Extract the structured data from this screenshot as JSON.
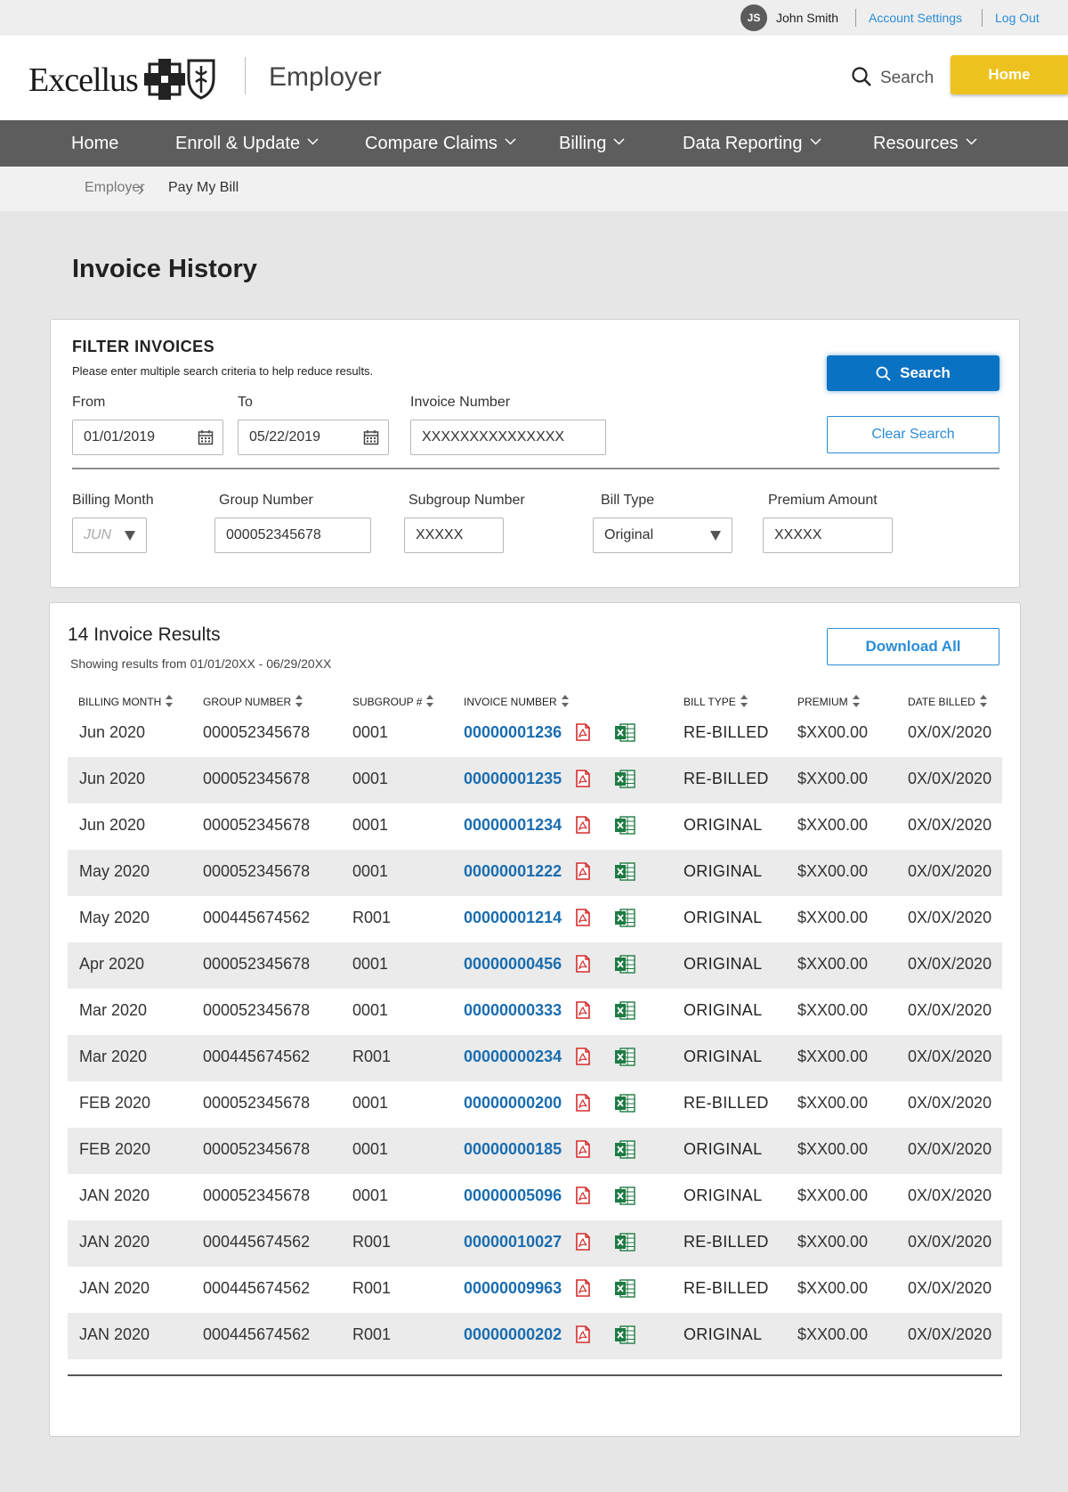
{
  "user": {
    "initials": "JS",
    "name": "John Smith",
    "account_settings": "Account Settings",
    "log_out": "Log Out"
  },
  "header": {
    "logo": "Excellus",
    "portal": "Employer",
    "search_label": "Search",
    "home_button": "Home"
  },
  "nav": [
    "Home",
    "Enroll & Update",
    "Compare Claims",
    "Billing",
    "Data Reporting",
    "Resources"
  ],
  "breadcrumb": {
    "parent": "Employer",
    "current": "Pay My Bill"
  },
  "page": {
    "title": "Invoice History"
  },
  "filter": {
    "title": "FILTER INVOICES",
    "subtitle": "Please enter multiple search criteria to help reduce results.",
    "from_label": "From",
    "from_value": "01/01/2019",
    "to_label": "To",
    "to_value": "05/22/2019",
    "invoice_label": "Invoice Number",
    "invoice_value": "XXXXXXXXXXXXXXX",
    "billing_month_label": "Billing Month",
    "billing_month_value": "JUN",
    "group_label": "Group Number",
    "group_value": "000052345678",
    "subgroup_label": "Subgroup Number",
    "subgroup_value": "XXXXX",
    "bill_type_label": "Bill Type",
    "bill_type_value": "Original",
    "premium_label": "Premium Amount",
    "premium_value": "XXXXX",
    "search_button": "Search",
    "clear_button": "Clear Search"
  },
  "results": {
    "title": "14 Invoice Results",
    "range": "Showing results from  01/01/20XX - 06/29/20XX",
    "download_all": "Download All",
    "columns": [
      "BILLING MONTH",
      "GROUP NUMBER",
      "SUBGROUP #",
      "INVOICE NUMBER",
      "BILL TYPE",
      "PREMIUM",
      "DATE BILLED"
    ],
    "rows": [
      {
        "month": "Jun  2020",
        "group": "000052345678",
        "subgroup": "0001",
        "invoice": "00000001236",
        "bill_type": "RE-BILLED",
        "premium": "$XX00.00",
        "date": "0X/0X/2020"
      },
      {
        "month": "Jun  2020",
        "group": "000052345678",
        "subgroup": "0001",
        "invoice": "00000001235",
        "bill_type": "RE-BILLED",
        "premium": "$XX00.00",
        "date": "0X/0X/2020"
      },
      {
        "month": "Jun  2020",
        "group": "000052345678",
        "subgroup": "0001",
        "invoice": "00000001234",
        "bill_type": "ORIGINAL",
        "premium": "$XX00.00",
        "date": "0X/0X/2020"
      },
      {
        "month": "May  2020",
        "group": "000052345678",
        "subgroup": "0001",
        "invoice": "00000001222",
        "bill_type": "ORIGINAL",
        "premium": "$XX00.00",
        "date": "0X/0X/2020"
      },
      {
        "month": "May  2020",
        "group": "000445674562",
        "subgroup": "R001",
        "invoice": "00000001214",
        "bill_type": "ORIGINAL",
        "premium": "$XX00.00",
        "date": "0X/0X/2020"
      },
      {
        "month": "Apr  2020",
        "group": "000052345678",
        "subgroup": "0001",
        "invoice": "00000000456",
        "bill_type": "ORIGINAL",
        "premium": "$XX00.00",
        "date": "0X/0X/2020"
      },
      {
        "month": "Mar  2020",
        "group": "000052345678",
        "subgroup": "0001",
        "invoice": "00000000333",
        "bill_type": "ORIGINAL",
        "premium": "$XX00.00",
        "date": "0X/0X/2020"
      },
      {
        "month": "Mar  2020",
        "group": "000445674562",
        "subgroup": "R001",
        "invoice": "00000000234",
        "bill_type": "ORIGINAL",
        "premium": "$XX00.00",
        "date": "0X/0X/2020"
      },
      {
        "month": "FEB  2020",
        "group": "000052345678",
        "subgroup": "0001",
        "invoice": "00000000200",
        "bill_type": "RE-BILLED",
        "premium": "$XX00.00",
        "date": "0X/0X/2020"
      },
      {
        "month": "FEB  2020",
        "group": "000052345678",
        "subgroup": "0001",
        "invoice": "00000000185",
        "bill_type": "ORIGINAL",
        "premium": "$XX00.00",
        "date": "0X/0X/2020"
      },
      {
        "month": "JAN  2020",
        "group": "000052345678",
        "subgroup": "0001",
        "invoice": "00000005096",
        "bill_type": "ORIGINAL",
        "premium": "$XX00.00",
        "date": "0X/0X/2020"
      },
      {
        "month": "JAN  2020",
        "group": "000445674562",
        "subgroup": "R001",
        "invoice": "00000010027",
        "bill_type": "RE-BILLED",
        "premium": "$XX00.00",
        "date": "0X/0X/2020"
      },
      {
        "month": "JAN  2020",
        "group": "000445674562",
        "subgroup": "R001",
        "invoice": "00000009963",
        "bill_type": "RE-BILLED",
        "premium": "$XX00.00",
        "date": "0X/0X/2020"
      },
      {
        "month": "JAN  2020",
        "group": "000445674562",
        "subgroup": "R001",
        "invoice": "00000000202",
        "bill_type": "ORIGINAL",
        "premium": "$XX00.00",
        "date": "0X/0X/2020"
      }
    ]
  },
  "icons": {
    "pdf": "pdf-icon",
    "excel": "excel-icon",
    "calendar": "calendar-icon",
    "sort": "sort-icon",
    "search": "search-icon"
  },
  "colors": {
    "accent": "#0a72c2",
    "link": "#1a6db0",
    "home_button": "#eec21e",
    "nav": "#5d5d5d",
    "pdf": "#d62b2b",
    "excel": "#1e7a43"
  }
}
